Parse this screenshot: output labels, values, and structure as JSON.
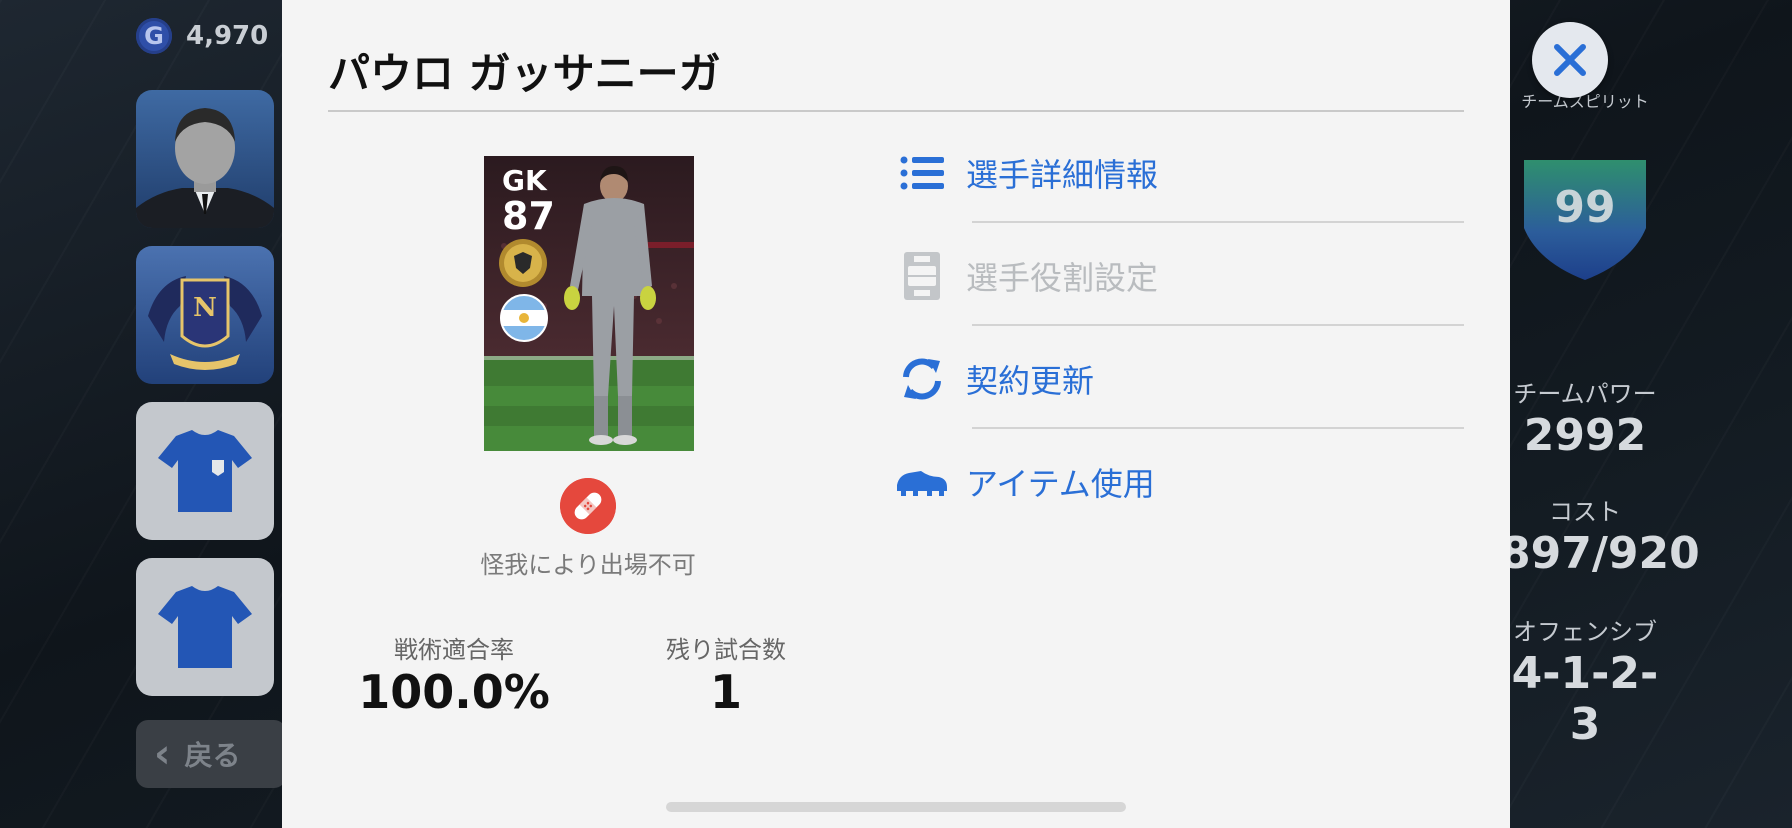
{
  "gp": {
    "icon_letter": "G",
    "amount": "4,970"
  },
  "back_label": "戻る",
  "team": {
    "spirit_label": "チームスピリット",
    "spirit_value": "99",
    "power_label": "チームパワー",
    "power_value": "2992",
    "cost_label": "コスト",
    "cost_value": "897/920",
    "strategy_label": "オフェンシブ",
    "formation": "4-1-2-3"
  },
  "modal": {
    "player_name": "パウロ ガッサニーガ",
    "card": {
      "position": "GK",
      "rating": "87"
    },
    "injury_text": "怪我により出場不可",
    "stats": [
      {
        "label": "戦術適合率",
        "value": "100.0%"
      },
      {
        "label": "残り試合数",
        "value": "1"
      }
    ],
    "menu": [
      {
        "label": "選手詳細情報",
        "icon": "list-icon",
        "enabled": true
      },
      {
        "label": "選手役割設定",
        "icon": "pitch-icon",
        "enabled": false
      },
      {
        "label": "契約更新",
        "icon": "refresh-icon",
        "enabled": true
      },
      {
        "label": "アイテム使用",
        "icon": "boot-icon",
        "enabled": true
      }
    ]
  },
  "colors": {
    "accent": "#2a6fd6",
    "injury": "#e5483d",
    "disabled": "#b9bcbf"
  }
}
